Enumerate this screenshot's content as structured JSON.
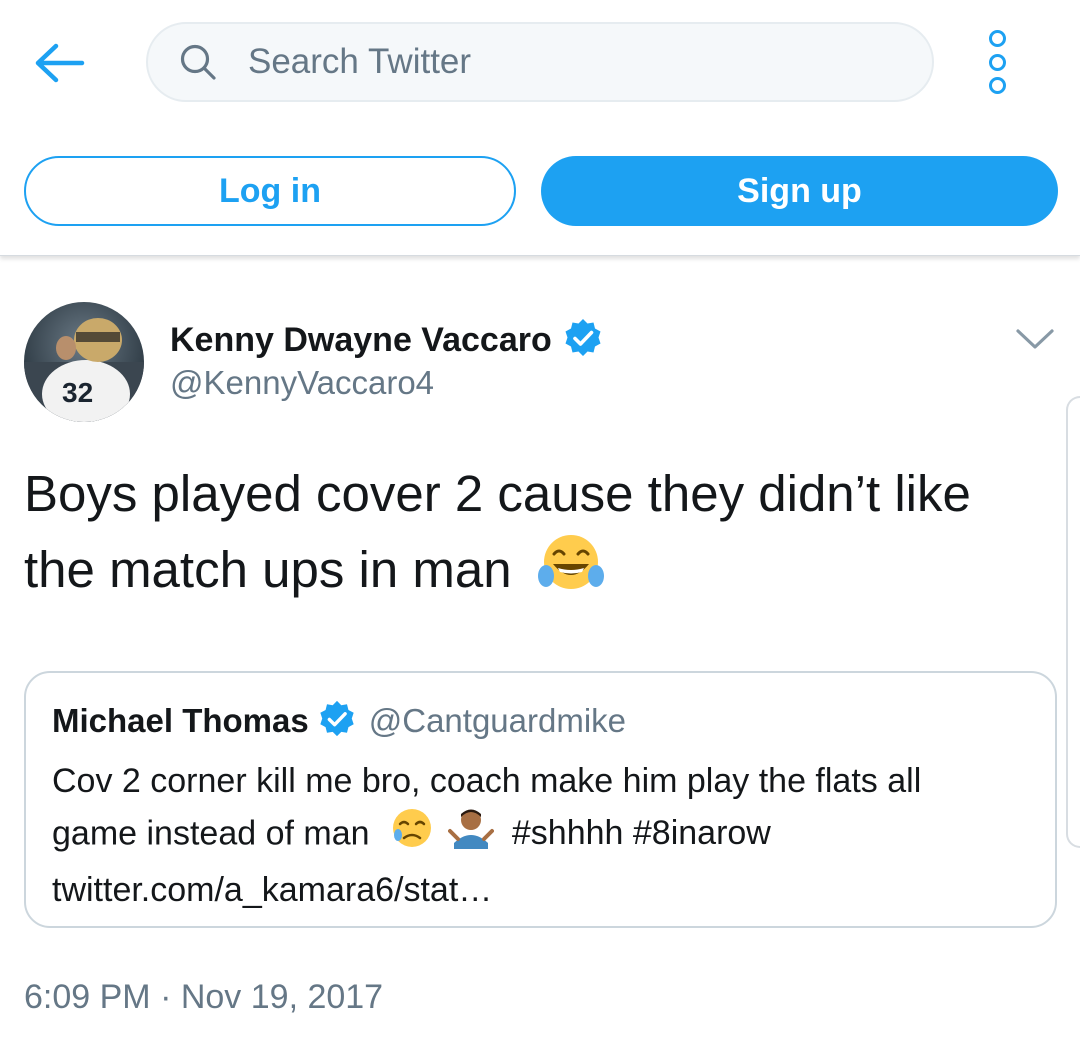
{
  "header": {
    "back_icon": "arrow-left-icon",
    "search": {
      "placeholder": "Search Twitter",
      "value": "",
      "icon": "search-icon"
    },
    "more_icon": "more-vertical-icon",
    "login_label": "Log in",
    "signup_label": "Sign up"
  },
  "tweet": {
    "author_name": "Kenny Dwayne Vaccaro",
    "author_handle": "@KennyVaccaro4",
    "avatar_jersey_number": "32",
    "verified_icon": "verified-badge-icon",
    "caret_icon": "chevron-down-icon",
    "text_line1": "Boys played cover 2 cause they didn’t like",
    "text_line2": "the match ups in man",
    "emoji": "face-with-tears-of-joy-emoji",
    "timestamp": "6:09 PM · Nov 19, 2017"
  },
  "quoted_tweet": {
    "author_name": "Michael Thomas",
    "author_handle": "@Cantguardmike",
    "line1": "Cov 2 corner kill me bro, coach make him play the flats all",
    "line2_prefix": "game instead of man",
    "hashtags": "#shhhh #8inarow",
    "link": "twitter.com/a_kamara6/stat…",
    "emojis": [
      "sad-face-emoji",
      "person-shrugging-emoji"
    ]
  },
  "colors": {
    "brand_blue": "#1da1f2",
    "text": "#14171a",
    "secondary_text": "#657786",
    "border": "#ccd6dd"
  }
}
